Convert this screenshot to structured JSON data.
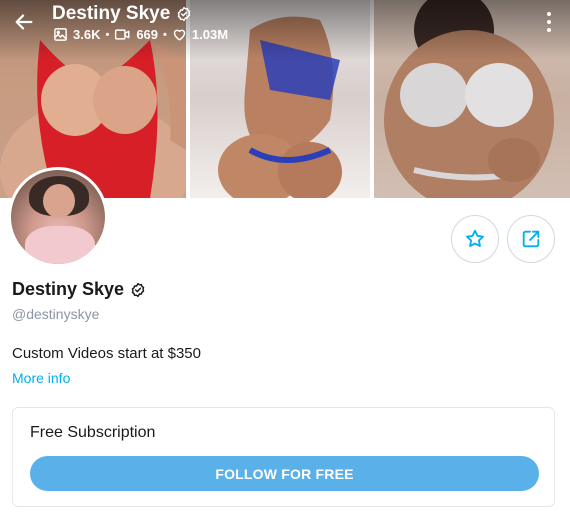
{
  "header": {
    "name": "Destiny Skye",
    "stats": {
      "photos": "3.6K",
      "videos": "669",
      "likes": "1.03M"
    }
  },
  "profile": {
    "name": "Destiny Skye",
    "handle": "@destinyskye",
    "bio": "Custom Videos start at $350",
    "more_info_label": "More info"
  },
  "subscription": {
    "title": "Free Subscription",
    "button_label": "FOLLOW FOR FREE"
  },
  "colors": {
    "accent": "#00aff0",
    "button": "#5ab0e8",
    "muted_text": "#8a96a3",
    "border": "#e3e8ed"
  },
  "icons": [
    "back-arrow-icon",
    "verified-badge-icon",
    "image-icon",
    "video-icon",
    "heart-icon",
    "more-vertical-icon",
    "star-icon",
    "share-icon"
  ]
}
